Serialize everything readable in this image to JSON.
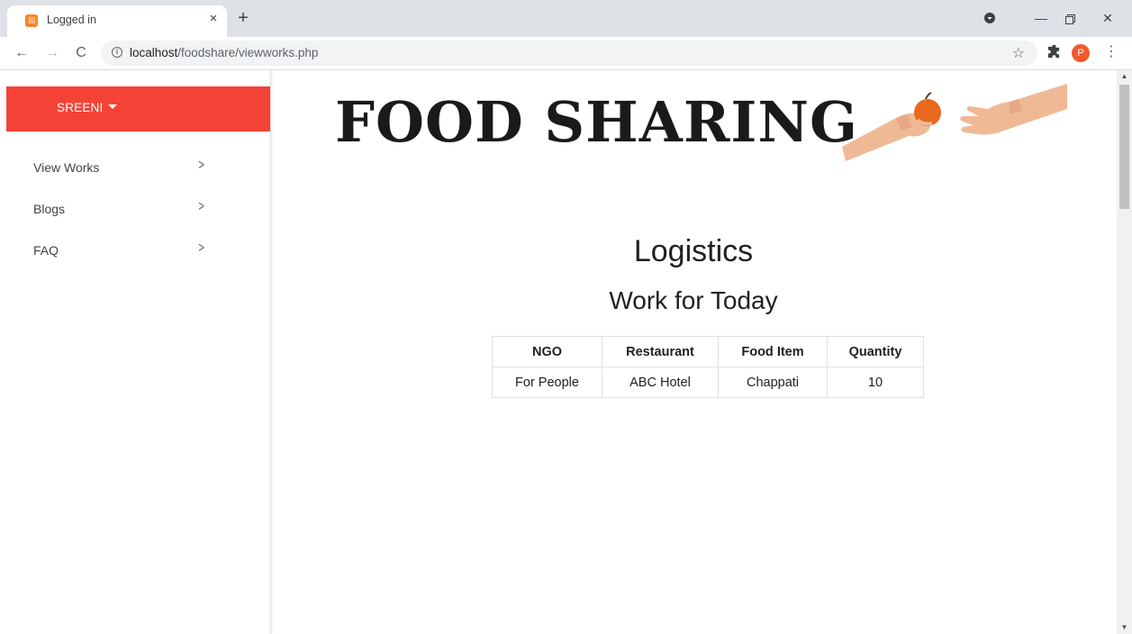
{
  "browser": {
    "tab_title": "Logged in",
    "tab_close": "×",
    "new_tab": "+",
    "url_host": "localhost",
    "url_path": "/foodshare/viewworks.php",
    "profile_initial": "P"
  },
  "sidebar": {
    "user_name": "SREENI",
    "items": [
      {
        "label": "View Works"
      },
      {
        "label": "Blogs"
      },
      {
        "label": "FAQ"
      }
    ]
  },
  "banner": {
    "title": "FOOD SHARING"
  },
  "main": {
    "heading": "Logistics",
    "subheading": "Work for Today",
    "table": {
      "headers": [
        "NGO",
        "Restaurant",
        "Food Item",
        "Quantity"
      ],
      "rows": [
        [
          "For People",
          "ABC Hotel",
          "Chappati",
          "10"
        ]
      ]
    }
  },
  "colors": {
    "accent": "#f44336",
    "tabbar": "#dee1e6"
  }
}
